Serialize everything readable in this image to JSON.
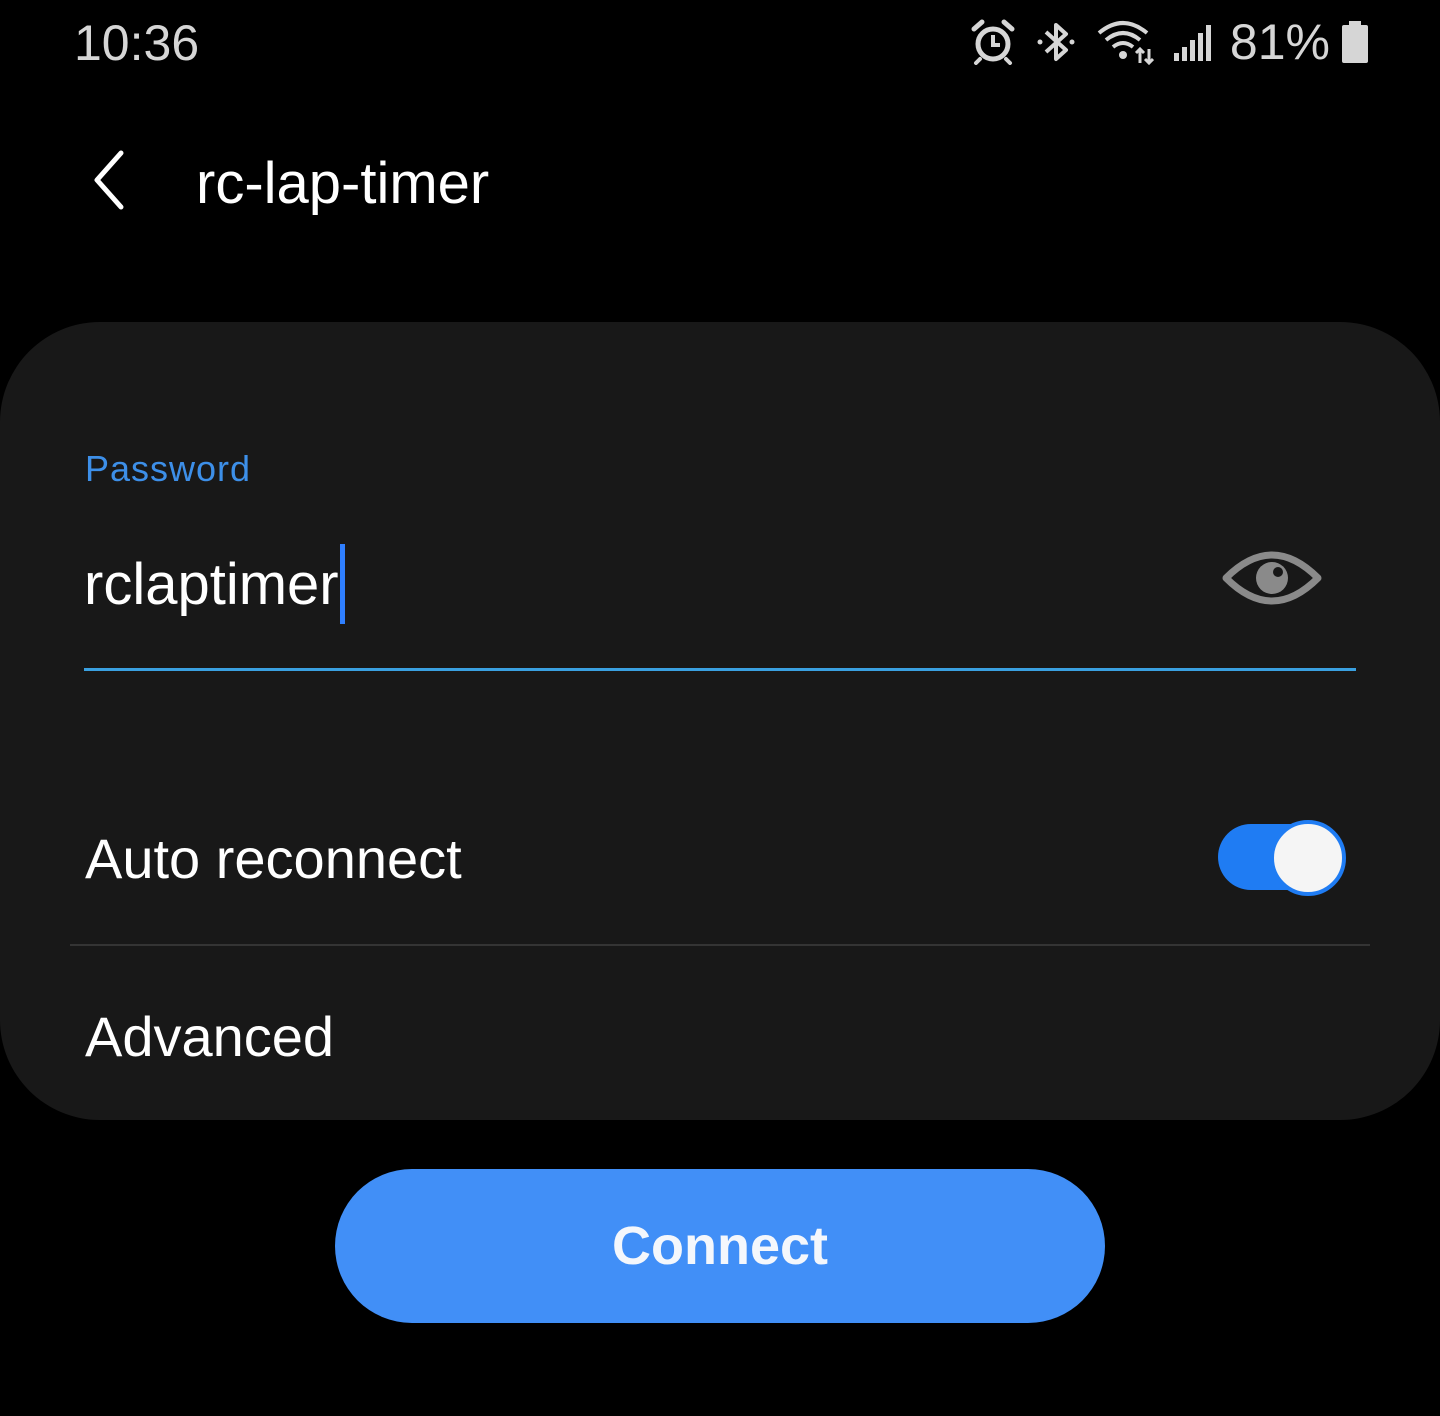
{
  "status_bar": {
    "time": "10:36",
    "battery_percent": "81%",
    "battery_level": 0.81,
    "icons": [
      "alarm-icon",
      "bluetooth-icon",
      "wifi-icon",
      "signal-icon",
      "battery-icon"
    ]
  },
  "header": {
    "title": "rc-lap-timer",
    "back_icon": "chevron-left-icon"
  },
  "form": {
    "password_label": "Password",
    "password_value": "rclaptimer",
    "show_password_icon": "eye-icon",
    "auto_reconnect_label": "Auto reconnect",
    "auto_reconnect_on": true,
    "advanced_label": "Advanced"
  },
  "actions": {
    "connect_label": "Connect"
  },
  "colors": {
    "accent": "#1f7cf3",
    "connect_button": "#418ff7",
    "label_blue": "#3d8fe8",
    "card_background": "#181818",
    "page_background": "#000000"
  }
}
